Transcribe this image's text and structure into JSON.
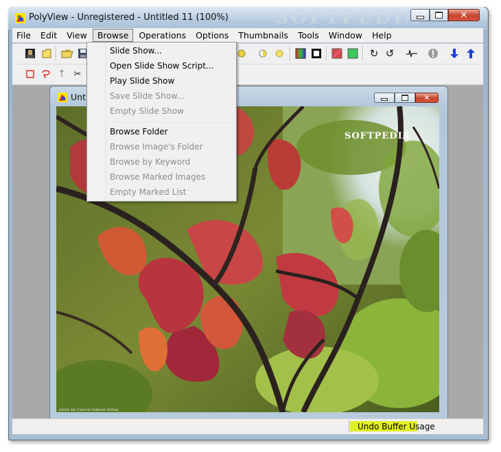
{
  "window": {
    "title": "PolyView - Unregistered - Untitled 11 (100%)",
    "watermark": "SOFTPEDIA"
  },
  "menubar": {
    "items": [
      {
        "label": "File"
      },
      {
        "label": "Edit"
      },
      {
        "label": "View"
      },
      {
        "label": "Browse",
        "active": true
      },
      {
        "label": "Operations"
      },
      {
        "label": "Options"
      },
      {
        "label": "Thumbnails"
      },
      {
        "label": "Tools"
      },
      {
        "label": "Window"
      },
      {
        "label": "Help"
      }
    ]
  },
  "browse_menu": {
    "items": [
      {
        "label": "Slide Show...",
        "enabled": true
      },
      {
        "label": "Open Slide Show Script...",
        "enabled": true
      },
      {
        "label": "Play Slide Show",
        "enabled": true
      },
      {
        "label": "Save Slide Show...",
        "enabled": false
      },
      {
        "label": "Empty Slide Show",
        "enabled": false
      },
      {
        "label": "Browse Folder",
        "enabled": true
      },
      {
        "label": "Browse Image's Folder",
        "enabled": false
      },
      {
        "label": "Browse by Keyword",
        "enabled": false
      },
      {
        "label": "Browse Marked Images",
        "enabled": false
      },
      {
        "label": "Empty Marked List",
        "enabled": false
      }
    ]
  },
  "child_window": {
    "title": "Unti"
  },
  "image": {
    "watermark": "SOFTPEDIA",
    "credit": "photo by Cosmin Gabriel Antea"
  },
  "statusbar": {
    "undo_label": "Undo Buffer Usage",
    "undo_color": "#e2ef25"
  },
  "colors": {
    "menu_bg": "#f0f0f0",
    "disabled_text": "#8d8d8d",
    "close_red": "#c6442c",
    "arrow_blue": "#1e3fd6"
  }
}
